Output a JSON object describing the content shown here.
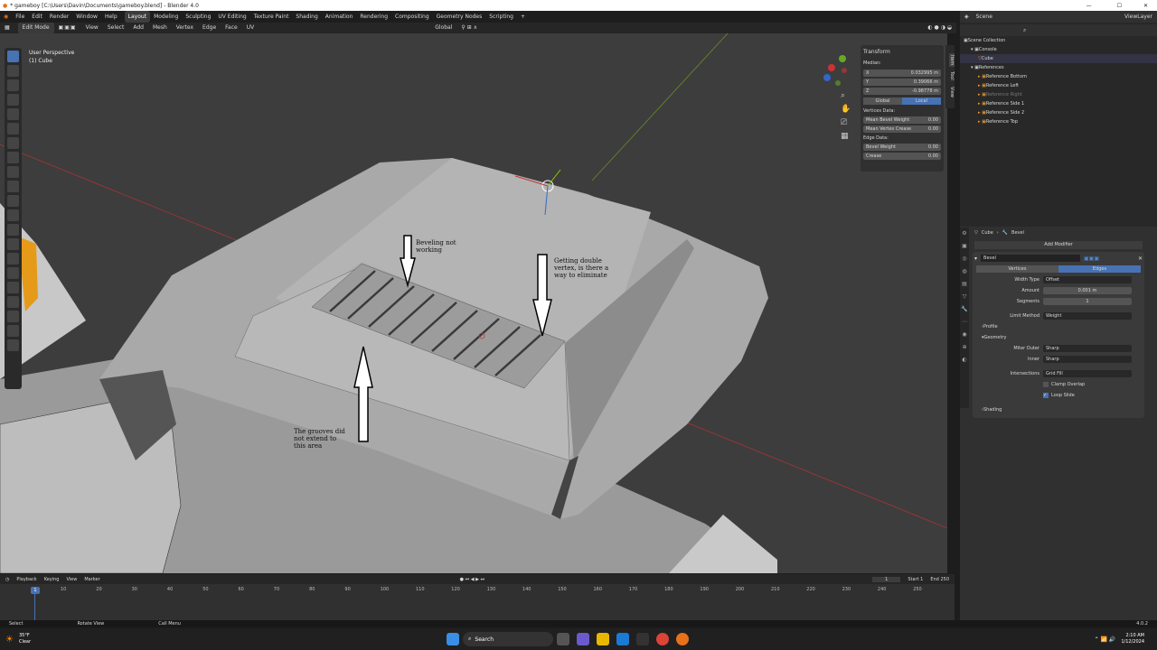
{
  "window": {
    "title": "* gameboy [C:\\Users\\Davin\\Documents\\gameboy.blend] - Blender 4.0"
  },
  "menu": {
    "items": [
      "File",
      "Edit",
      "Render",
      "Window",
      "Help"
    ],
    "workspaces": [
      "Layout",
      "Modeling",
      "Sculpting",
      "UV Editing",
      "Texture Paint",
      "Shading",
      "Animation",
      "Rendering",
      "Compositing",
      "Geometry Nodes",
      "Scripting"
    ],
    "active": "Layout"
  },
  "header3d": {
    "mode": "Edit Mode",
    "items": [
      "View",
      "Select",
      "Add",
      "Mesh",
      "Vertex",
      "Edge",
      "Face",
      "UV"
    ],
    "orientation": "Global",
    "options": "Options"
  },
  "viewport": {
    "perspective": "User Perspective",
    "object": "(1) Cube",
    "annotations": {
      "a1_l1": "Beveling not",
      "a1_l2": "working",
      "a2_l1": "Getting double",
      "a2_l2": "vertex, is there a",
      "a2_l3": "way to eliminate",
      "a3_l1": "The grooves did",
      "a3_l2": "not extend to",
      "a3_l3": "this area"
    }
  },
  "npanel": {
    "title": "Transform",
    "median": "Median:",
    "x_label": "X",
    "x": "0.032995 m",
    "y_label": "Y",
    "y": "0.39066 m",
    "z_label": "Z",
    "z": "-0.98778 m",
    "global": "Global",
    "local": "Local",
    "vdata": "Vertices Data:",
    "mbw": "Mean Bevel Weight",
    "mbw_v": "0.00",
    "mvc": "Mean Vertex Crease",
    "mvc_v": "0.00",
    "edata": "Edge Data:",
    "bw": "Bevel Weight",
    "bw_v": "0.00",
    "cr": "Crease",
    "cr_v": "0.00",
    "tabs": [
      "Item",
      "Tool",
      "View"
    ]
  },
  "outliner": {
    "scene": "Scene",
    "viewlayer": "ViewLayer",
    "collection": "Scene Collection",
    "items": [
      {
        "label": "Console"
      },
      {
        "label": "Cube"
      },
      {
        "label": "References"
      },
      {
        "label": "Reference Bottom"
      },
      {
        "label": "Reference Left"
      },
      {
        "label": "Reference Right"
      },
      {
        "label": "Reference Side 1"
      },
      {
        "label": "Reference Side 2"
      },
      {
        "label": "Reference Top"
      }
    ]
  },
  "properties": {
    "crumb_obj": "Cube",
    "crumb_mod": "Bevel",
    "add": "Add Modifier",
    "modname": "Bevel",
    "vertices": "Vertices",
    "edges": "Edges",
    "width_type_l": "Width Type",
    "width_type": "Offset",
    "amount_l": "Amount",
    "amount": "0.001 m",
    "segments_l": "Segments",
    "segments": "1",
    "limit_l": "Limit Method",
    "limit": "Weight",
    "profile": "Profile",
    "geometry": "Geometry",
    "miter_outer_l": "Miter Outer",
    "miter_outer": "Sharp",
    "inner_l": "Inner",
    "inner": "Sharp",
    "intersections_l": "Intersections",
    "intersections": "Grid Fill",
    "clamp": "Clamp Overlap",
    "loop": "Loop Slide",
    "shading": "Shading"
  },
  "timeline": {
    "playback": "Playback",
    "keying": "Keying",
    "view": "View",
    "marker": "Marker",
    "current": "1",
    "start_l": "Start",
    "start": "1",
    "end_l": "End",
    "end": "250",
    "ticks": [
      "1",
      "10",
      "20",
      "30",
      "40",
      "50",
      "60",
      "70",
      "80",
      "90",
      "100",
      "110",
      "120",
      "130",
      "140",
      "150",
      "160",
      "170",
      "180",
      "190",
      "200",
      "210",
      "220",
      "230",
      "240",
      "250"
    ]
  },
  "status": {
    "select": "Select",
    "rotate": "Rotate View",
    "menu": "Call Menu",
    "version": "4.0.2"
  },
  "taskbar": {
    "temp": "35°F",
    "weather": "Clear",
    "search": "Search",
    "time": "2:10 AM",
    "date": "1/12/2024"
  }
}
